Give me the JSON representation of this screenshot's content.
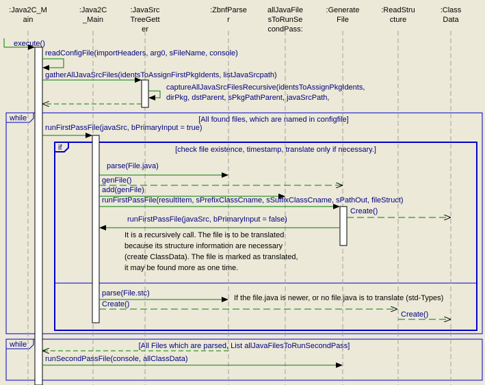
{
  "diagram": {
    "colors": {
      "background": "#ece9d8",
      "lifeline": "#a0a0a0",
      "message_text": "#000080",
      "fragment_border": "#0000cc",
      "message_line": "#008000",
      "arrow_head": "#000000",
      "execute_fill": "#ffffff",
      "note_text": "#000000"
    },
    "participants": [
      {
        "id": "java2c_main_1",
        "lines": [
          ":Java2C_M",
          "ain"
        ]
      },
      {
        "id": "java2c_main_2",
        "lines": [
          ":Java2C",
          "_Main"
        ]
      },
      {
        "id": "javasrc_tree_getter",
        "lines": [
          ":JavaSrc",
          "TreeGett",
          "er"
        ]
      },
      {
        "id": "zbnf_parser",
        "lines": [
          ":ZbnfParse",
          "r"
        ]
      },
      {
        "id": "all_java_files",
        "lines": [
          "allJavaFile",
          "sToRunSe",
          "condPass:"
        ]
      },
      {
        "id": "generate_file",
        "lines": [
          ":Generate",
          "File"
        ]
      },
      {
        "id": "read_structure",
        "lines": [
          ":ReadStru",
          "cture"
        ]
      },
      {
        "id": "class_data",
        "lines": [
          ":Class",
          "Data"
        ]
      }
    ],
    "messages": {
      "execute": "execute()",
      "read_config": "readConfigFile(importHeaders, arg0, sFileName, console)",
      "gather": "gatherAllJavaSrcFiles(identsToAssignFirstPkgIdents, listJavaSrcpath)",
      "capture_line1": "captureAllJavaSrcFilesRecursive(identsToAssignPkgIdents,",
      "capture_line2": "dirPkg, dstParent, sPkgPathParent, javaSrcPath,",
      "run_first_pass": "runFirstPassFile(javaSrc, bPrimaryInput = true)",
      "parse_java": "parse(File.java)",
      "gen_file": "genFile()",
      "add_gen_file": "add(genFile)",
      "run_first_pass_result": "runFirstPassFile(resultItem, sPrefixClassCname, sSuffixClassCname, sPathOut, fileStruct)",
      "create_1": "Create()",
      "run_first_pass_recursive": "runFirstPassFile(javaSrc, bPrimaryInput = false)",
      "parse_stc": "parse(File.stc)",
      "create_2": "Create()",
      "create_3": "Create()",
      "run_second_pass": "runSecondPassFile(console, allClassData)"
    },
    "fragments": {
      "while_1": {
        "label": "while",
        "guard": "[All found files, which are named in configfile]"
      },
      "if_1": {
        "label": "if",
        "guard": "[check file existence, timestamp, translate only if necessary.]"
      },
      "while_2": {
        "label": "while",
        "guard": "[All Files which are parsed, List allJavaFilesToRunSecondPass]"
      }
    },
    "notes": {
      "recursive_note": [
        "It is a recursively call. The file is to be translated",
        "because its structure information are necessary",
        "(create ClassData). The file is marked as translated,",
        "it may be found more as one time."
      ],
      "stc_note": "If the file.java is newer, or no file.java is to translate (std-Types)"
    }
  }
}
